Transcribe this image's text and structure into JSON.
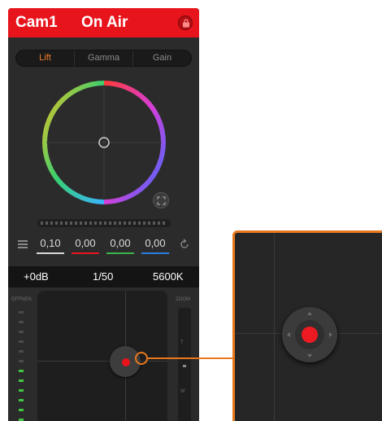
{
  "header": {
    "camera": "Cam1",
    "status": "On Air",
    "lock_icon": "lock-icon",
    "accent": "#e8141c"
  },
  "tabs": [
    {
      "label": "Lift",
      "active": true
    },
    {
      "label": "Gamma",
      "active": false
    },
    {
      "label": "Gain",
      "active": false
    }
  ],
  "color_wheel": {
    "reset_icon": "expand-icon"
  },
  "values": [
    {
      "label": "0,10",
      "color": "#d9d9d9"
    },
    {
      "label": "0,00",
      "color": "#e8141c"
    },
    {
      "label": "0,00",
      "color": "#3bb54a"
    },
    {
      "label": "0,00",
      "color": "#2f7de1"
    }
  ],
  "status_bar": {
    "gain": "+0dB",
    "shutter": "1/50",
    "white_balance": "5600K"
  },
  "iris": {
    "label": "ÖFFNEN"
  },
  "zoom": {
    "label": "ZOOM",
    "tele": "T",
    "wide": "W"
  },
  "callout_color": "#e8781e"
}
